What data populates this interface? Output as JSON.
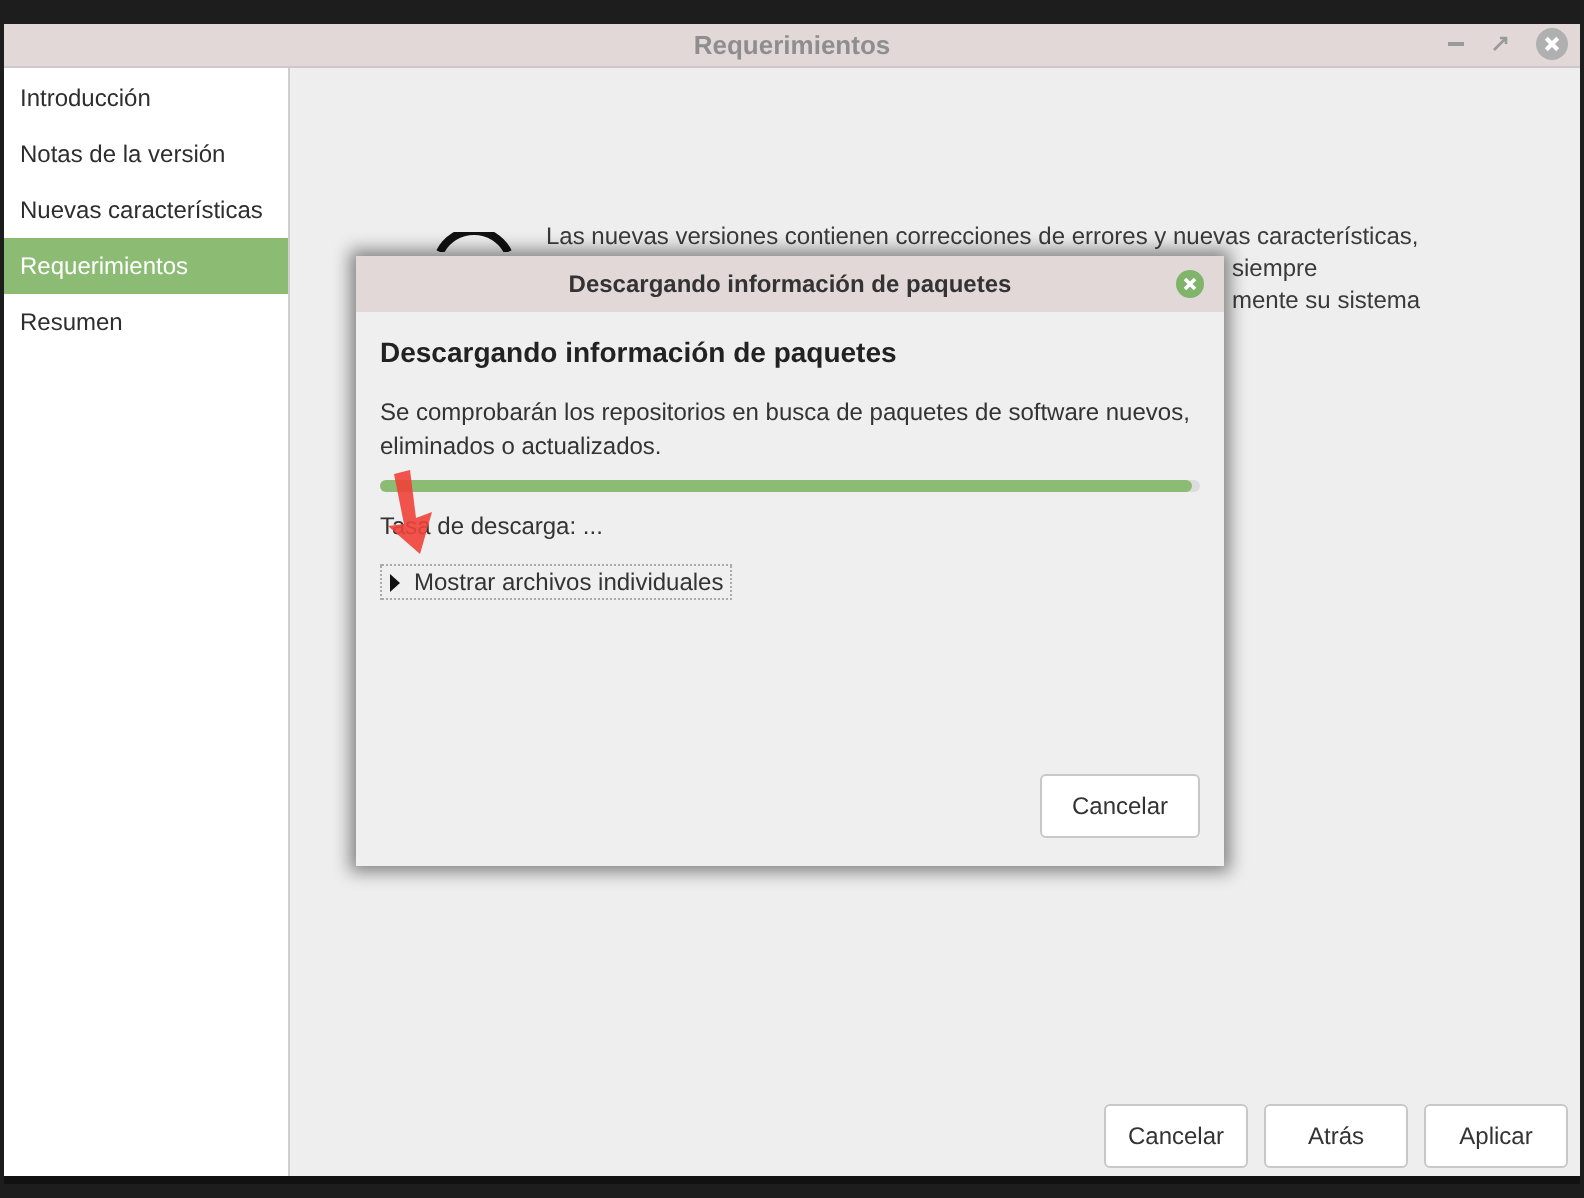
{
  "window": {
    "title": "Requerimientos"
  },
  "sidebar": {
    "items": [
      {
        "label": "Introducción",
        "selected": false
      },
      {
        "label": "Notas de la versión",
        "selected": false
      },
      {
        "label": "Nuevas características",
        "selected": false
      },
      {
        "label": "Requerimientos",
        "selected": true
      },
      {
        "label": "Resumen",
        "selected": false
      }
    ]
  },
  "background_text": {
    "line_1": "Las nuevas versiones contienen correcciones de errores y nuevas características,",
    "line_2": "siempre",
    "line_3": "mente su sistema"
  },
  "dialog": {
    "title": "Descargando información de paquetes",
    "heading": "Descargando información de paquetes",
    "description": "Se comprobarán los repositorios en busca de paquetes de software nuevos, eliminados o actualizados.",
    "progress": {
      "level": 0.99
    },
    "rate": "Tasa de descarga: ...",
    "expander": {
      "label": "Mostrar archivos individuales",
      "expanded": false
    },
    "button": "Cancelar"
  },
  "buttons": [
    "Cancelar",
    "Atrás",
    "Aplicar"
  ]
}
